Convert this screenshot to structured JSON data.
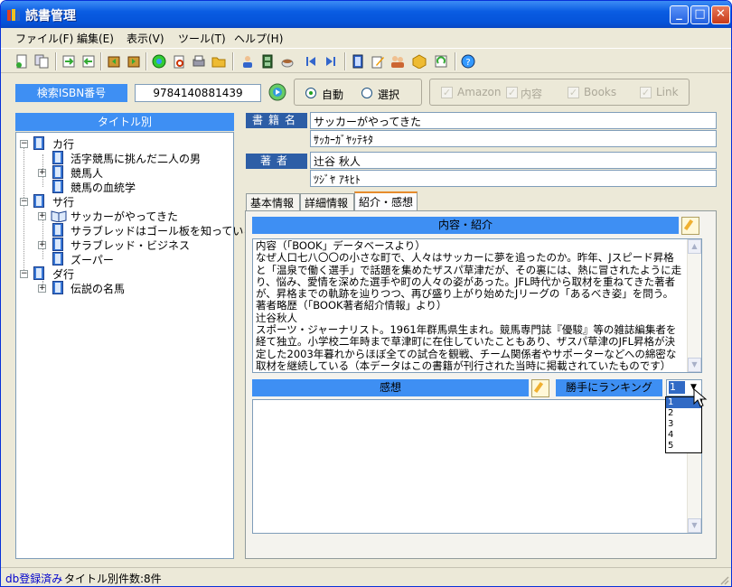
{
  "window": {
    "title": "読書管理"
  },
  "menu": [
    "ファイル(F)",
    "編集(E)",
    "表示(V)",
    "ツール(T)",
    "ヘルプ(H)"
  ],
  "toolbar_icons": [
    "new-icon",
    "copy-icon",
    "import-icon",
    "export-icon",
    "prev-icon",
    "next-icon",
    "web-icon",
    "search-icon",
    "print-icon",
    "folder-icon",
    "user-icon",
    "film-icon",
    "cup-icon",
    "first-icon",
    "last-icon",
    "book-icon",
    "edit-icon",
    "users-icon",
    "package-icon",
    "refresh-icon",
    "help-icon"
  ],
  "isbn": {
    "label": "検索ISBN番号",
    "value": "9784140881439"
  },
  "mode": {
    "auto": "自動",
    "select": "選択",
    "selected": "auto"
  },
  "sources": [
    {
      "label": "Amazon",
      "checked": true
    },
    {
      "label": "内容",
      "checked": true
    },
    {
      "label": "Books",
      "checked": true
    },
    {
      "label": "Link",
      "checked": true
    }
  ],
  "left_panel": {
    "header": "タイトル別"
  },
  "tree": {
    "groups": [
      {
        "label": "カ行",
        "items": [
          {
            "label": "活字競馬に挑んだ二人の男",
            "expandable": false
          },
          {
            "label": "競馬人",
            "expandable": true
          },
          {
            "label": "競馬の血統学",
            "expandable": false
          }
        ]
      },
      {
        "label": "サ行",
        "items": [
          {
            "label": "サッカーがやってきた",
            "expandable": true,
            "open_book": true
          },
          {
            "label": "サラブレッドはゴール板を知っているか",
            "expandable": false
          },
          {
            "label": "サラブレッド・ビジネス",
            "expandable": true
          },
          {
            "label": "ズーパー",
            "expandable": false
          }
        ]
      },
      {
        "label": "ダ行",
        "items": [
          {
            "label": "伝説の名馬",
            "expandable": true
          }
        ]
      }
    ]
  },
  "book": {
    "title_label": "書籍名",
    "title": "サッカーがやってきた",
    "title_kana": "ｻｯｶｰｶﾞﾔｯﾃｷﾀ",
    "author_label": "著者",
    "author": "辻谷 秋人",
    "author_kana": "ﾂｼﾞﾔ ｱｷﾋﾄ"
  },
  "tabs": [
    {
      "label": "基本情報",
      "active": false
    },
    {
      "label": "詳細情報",
      "active": false
    },
    {
      "label": "紹介・感想",
      "active": true
    }
  ],
  "content_section": {
    "header": "内容・紹介",
    "text": "内容（「BOOK」データベースより）\nなぜ人口七八〇〇の小さな町で、人々はサッカーに夢を追ったのか。昨年、Jスピード昇格と「温泉で働く選手」で話題を集めたザスパ草津だが、その裏には、熱に冒されたように走り、悩み、愛情を深めた選手や町の人々の姿があった。JFL時代から取材を重ねてきた著者が、昇格までの軌跡を辿りつつ、再び盛り上がり始めたJリーグの「あるべき姿」を問う。\n著者略歴（「BOOK著者紹介情報」より）\n辻谷秋人\nスポーツ・ジャーナリスト。1961年群馬県生まれ。競馬専門誌『優駿』等の雑誌編集者を経て独立。小学校二年時まで草津町に在住していたこともあり、ザスパ草津のJFL昇格が決定した2003年暮れからほぼ全ての試合を観戦、チーム関係者やサポーターなどへの綿密な取材を継続している（本データはこの書籍が刊行された当時に掲載されていたものです）"
  },
  "impression_section": {
    "header": "感想",
    "text": ""
  },
  "ranking": {
    "label": "勝手にランキング",
    "selected": "1",
    "options": [
      "1",
      "2",
      "3",
      "4",
      "5"
    ]
  },
  "status": {
    "db_state": "db登録済み",
    "count_text": "タイトル別件数:8件"
  },
  "colors": {
    "accent": "#3e8ff3",
    "label_dark": "#2d5ea6",
    "titlebar": "#0553d9",
    "bg": "#ece9d8"
  }
}
